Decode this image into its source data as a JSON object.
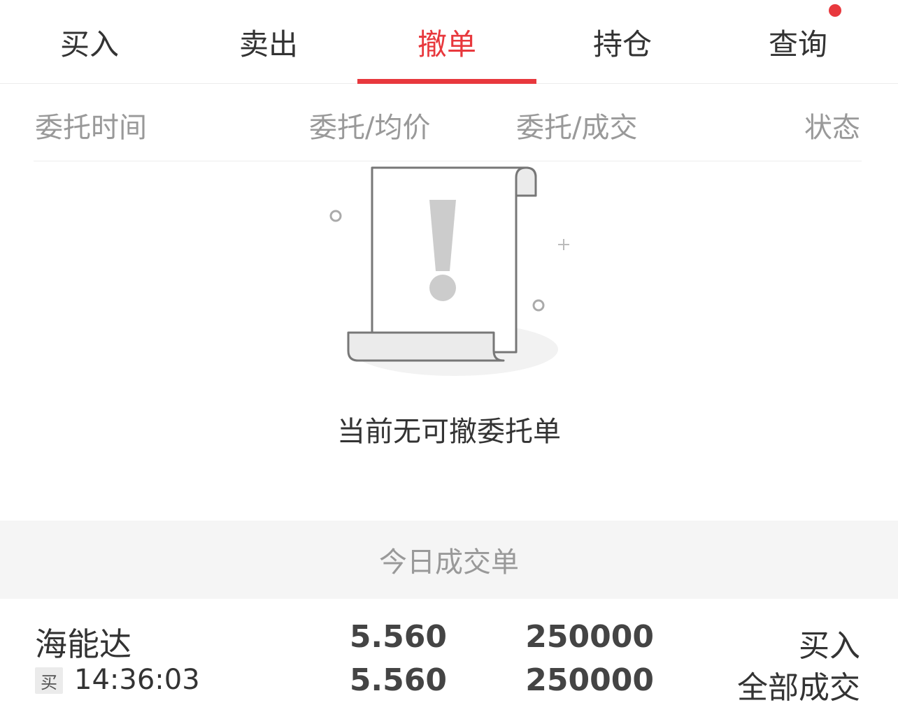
{
  "tabs": [
    {
      "label": "买入",
      "active": false
    },
    {
      "label": "卖出",
      "active": false
    },
    {
      "label": "撤单",
      "active": true
    },
    {
      "label": "持仓",
      "active": false
    },
    {
      "label": "查询",
      "active": false,
      "badge": true
    }
  ],
  "columns": {
    "time": "委托时间",
    "price": "委托/均价",
    "volume": "委托/成交",
    "status": "状态"
  },
  "empty_state": {
    "icon": "document-exclamation-icon",
    "message": "当前无可撤委托单"
  },
  "today_section": {
    "title": "今日成交单"
  },
  "trades": [
    {
      "stock_name": "海能达",
      "side_tag": "买",
      "time": "14:36:03",
      "order_price": "5.560",
      "avg_price": "5.560",
      "order_qty": "250000",
      "filled_qty": "250000",
      "direction": "买入",
      "status": "全部成交"
    }
  ],
  "colors": {
    "accent": "#e8383d",
    "text_primary": "#333333",
    "text_secondary": "#999999",
    "band_bg": "#f5f5f5"
  }
}
